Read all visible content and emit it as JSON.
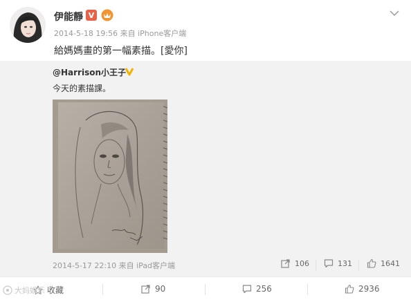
{
  "post": {
    "author": "伊能靜",
    "verified_mark": "V",
    "timestamp": "2014-5-18 19:56",
    "source": "来自 iPhone客户端",
    "text": "給媽媽畫的第一幅素描。[愛你]"
  },
  "repost": {
    "author": "@Harrison小王子",
    "text": "今天的素描課。",
    "timestamp": "2014-5-17 22:10",
    "source": "来自 iPad客户端",
    "image_label": "pencil sketch portrait",
    "stats": {
      "reposts": "106",
      "comments": "131",
      "likes": "1641"
    }
  },
  "actions": {
    "favorite": "收藏",
    "reposts": "90",
    "comments": "256",
    "likes": "2936"
  },
  "watermark": "大妈娱乐"
}
